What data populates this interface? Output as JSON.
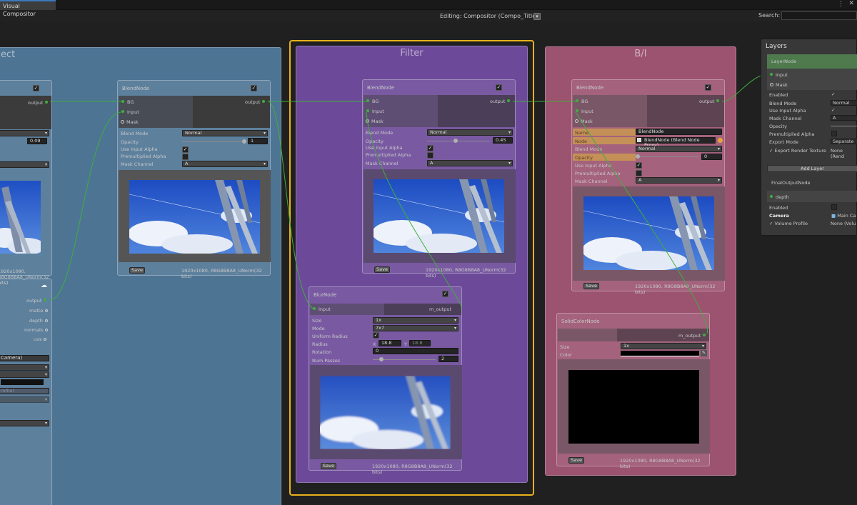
{
  "window": {
    "tab": "Visual Compositor",
    "editing": "Editing: Compositor (Compo_Title)",
    "search_label": "Search:",
    "search_value": ""
  },
  "groups": {
    "left": "ect",
    "filter": "Filter",
    "bi": "B/I"
  },
  "left_nodes": {
    "node1": {
      "output": "output",
      "value": "0.09",
      "res": "1920x1080, R8G8B8A8_UNorm(32 bits)"
    },
    "node2": {
      "ports": [
        "output",
        "matte",
        "depth",
        "normals",
        "uvs"
      ],
      "camera": "Camera)",
      "profile": "rofile)"
    }
  },
  "blend1": {
    "title": "BlendNode",
    "ports": {
      "bg": "BG",
      "input": "Input",
      "mask": "Mask",
      "output": "output"
    },
    "blend_mode_label": "Blend Mode",
    "blend_mode": "Normal",
    "opacity_label": "Opacity",
    "opacity": "1",
    "use_input_alpha": "Use Input Alpha",
    "premultiplied": "Premultiplied Alpha",
    "mask_channel_label": "Mask Channel",
    "mask_channel": "A",
    "save": "Save",
    "res": "1920x1080, R8G8B8A8_UNorm(32 bits)"
  },
  "blend2": {
    "title": "BlendNode",
    "ports": {
      "bg": "BG",
      "input": "Input",
      "mask": "Mask",
      "output": "output"
    },
    "blend_mode_label": "Blend Mode",
    "blend_mode": "Normal",
    "opacity_label": "Opacity",
    "opacity": "0.45",
    "use_input_alpha": "Use Input Alpha",
    "premultiplied": "Premultiplied Alpha",
    "mask_channel_label": "Mask Channel",
    "mask_channel": "A",
    "save": "Save",
    "res": "1920x1080, R8G8B8A8_UNorm(32 bits)"
  },
  "blur": {
    "title": "BlurNode",
    "ports": {
      "input": "Input",
      "output": "m_output"
    },
    "size_label": "Size",
    "size": "1x",
    "mode_label": "Mode",
    "mode": "7x7",
    "uniform_label": "Uniform Radius",
    "radius_label": "Radius",
    "x_label": "X",
    "x": "18.8",
    "y_label": "Y",
    "y": "18.8",
    "rotation_label": "Rotation",
    "rotation": "0",
    "passes_label": "Num Passes",
    "passes": "2",
    "save": "Save",
    "res": "1920x1080, R8G8B8A8_UNorm(32 bits)"
  },
  "blend3": {
    "title": "BlendNode",
    "ports": {
      "bg": "BG",
      "input": "Input",
      "mask": "Mask",
      "output": "output"
    },
    "name_label": "Name",
    "name": "BlendNode",
    "node_label": "Node",
    "node": "BlendNode (Blend Node Proxy)",
    "blend_mode_label": "Blend Mode",
    "blend_mode": "Normal",
    "opacity_label": "Opacity",
    "opacity": "0",
    "use_input_alpha": "Use Input Alpha",
    "premultiplied": "Premultiplied Alpha",
    "mask_channel_label": "Mask Channel",
    "mask_channel": "A",
    "save": "Save",
    "res": "1920x1080, R8G8B8A8_UNorm(32 bits)"
  },
  "solid": {
    "title": "SolidColorNode",
    "output": "m_output",
    "size_label": "Size",
    "size": "1x",
    "color_label": "Color",
    "save": "Save",
    "res": "1920x1080, R8G8B8A8_UNorm(32 bits)"
  },
  "layers": {
    "title": "Layers",
    "layer_node": "LayerNode",
    "input": "Input",
    "mask": "Mask",
    "enabled": "Enabled",
    "blend_mode_label": "Blend Mode",
    "blend_mode": "Normal",
    "use_input_alpha": "Use Input Alpha",
    "mask_channel_label": "Mask Channel",
    "mask_channel": "A",
    "opacity": "Opacity",
    "premultiplied": "Premultiplied Alpha",
    "export_mode_label": "Export Mode",
    "export_mode": "Separate",
    "export_render": "Export Render Texture",
    "export_render_value": "None (Rend",
    "add_layer": "Add Layer",
    "final_output": "FinalOutputNode",
    "depth": "depth",
    "enabled2": "Enabled",
    "camera_label": "Camera",
    "camera": "Main Ca",
    "volume_label": "Volume Profile",
    "volume": "None (Volu"
  },
  "colors": {
    "left_group": "#4e7494",
    "filter_group": "#6c4a99",
    "bi_group": "#9c5370",
    "selection": "#e8b21c",
    "wire": "#3fae3f",
    "layer_header": "#4e7a4e"
  }
}
